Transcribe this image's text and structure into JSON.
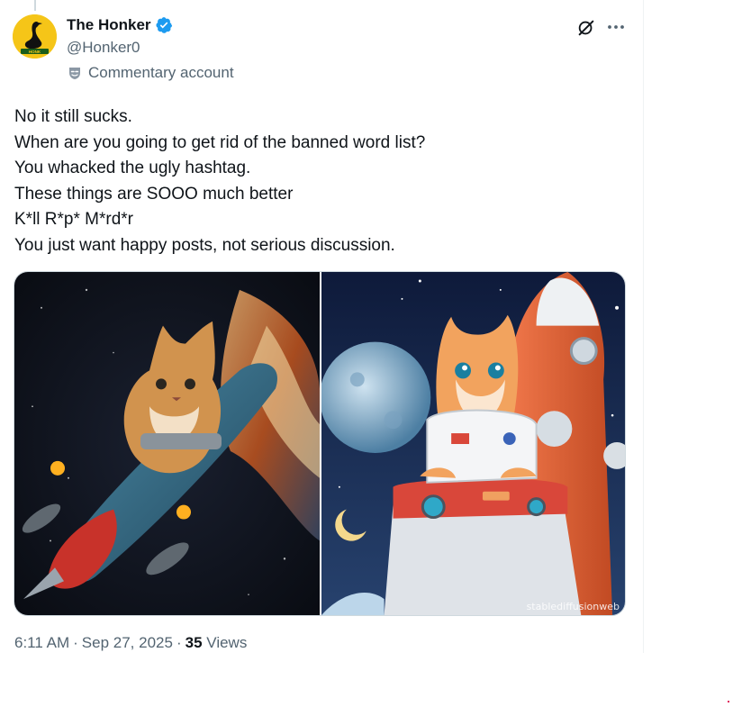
{
  "author": {
    "display_name": "The Honker",
    "handle": "@Honker0",
    "account_label": "Commentary account",
    "avatar_text": "HONK"
  },
  "tweet": {
    "lines": [
      "No it still sucks.",
      "When are you going to get rid of the banned word list?",
      "You whacked the ugly hashtag.",
      "These things are SOOO much better",
      "K*ll R*p* M*rd*r",
      "You just want happy posts, not serious discussion."
    ]
  },
  "media": {
    "left_alt": "cat riding rocket in space",
    "right_alt": "kitten astronaut in rocket",
    "watermark": "stablediffusionweb"
  },
  "meta": {
    "time": "6:11 AM",
    "separator": "·",
    "date": "Sep 27, 2025",
    "views_count": "35",
    "views_label": "Views"
  },
  "icons": {
    "verified": "verified-badge-icon",
    "commentary": "mask-icon",
    "grok": "grok-icon",
    "more": "more-icon"
  },
  "colors": {
    "verified": "#1d9bf0",
    "secondary_text": "#536471",
    "primary_text": "#0f1419",
    "avatar_bg": "#f5c518"
  }
}
